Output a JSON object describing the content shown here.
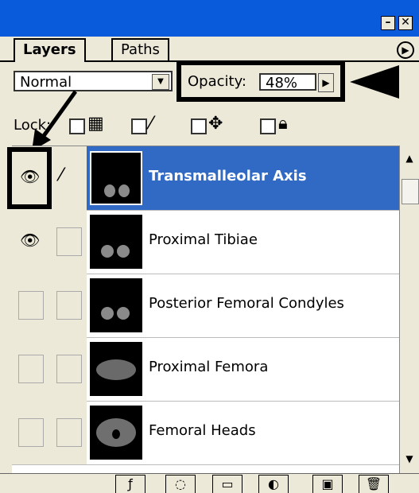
{
  "tabs": [
    {
      "label": "Layers"
    },
    {
      "label": "Paths"
    }
  ],
  "blend_mode": {
    "value": "Normal"
  },
  "opacity": {
    "label": "Opacity:",
    "value": "48%"
  },
  "lock": {
    "label": "Lock:"
  },
  "layers": [
    {
      "name": "Transmalleolar Axis",
      "visible": true,
      "selected": true
    },
    {
      "name": "Proximal Tibiae",
      "visible": true,
      "selected": false
    },
    {
      "name": "Posterior Femoral Condyles",
      "visible": false,
      "selected": false
    },
    {
      "name": "Proximal Femora",
      "visible": false,
      "selected": false
    },
    {
      "name": "Femoral Heads",
      "visible": false,
      "selected": false
    }
  ],
  "colors": {
    "title_bar": "#0a5adc",
    "selection": "#316ac5",
    "panel_bg": "#ece9d8"
  },
  "icons": {
    "visibility": "eye-icon",
    "link_brush": "brush-icon",
    "panel_menu": "panel-menu-icon"
  }
}
